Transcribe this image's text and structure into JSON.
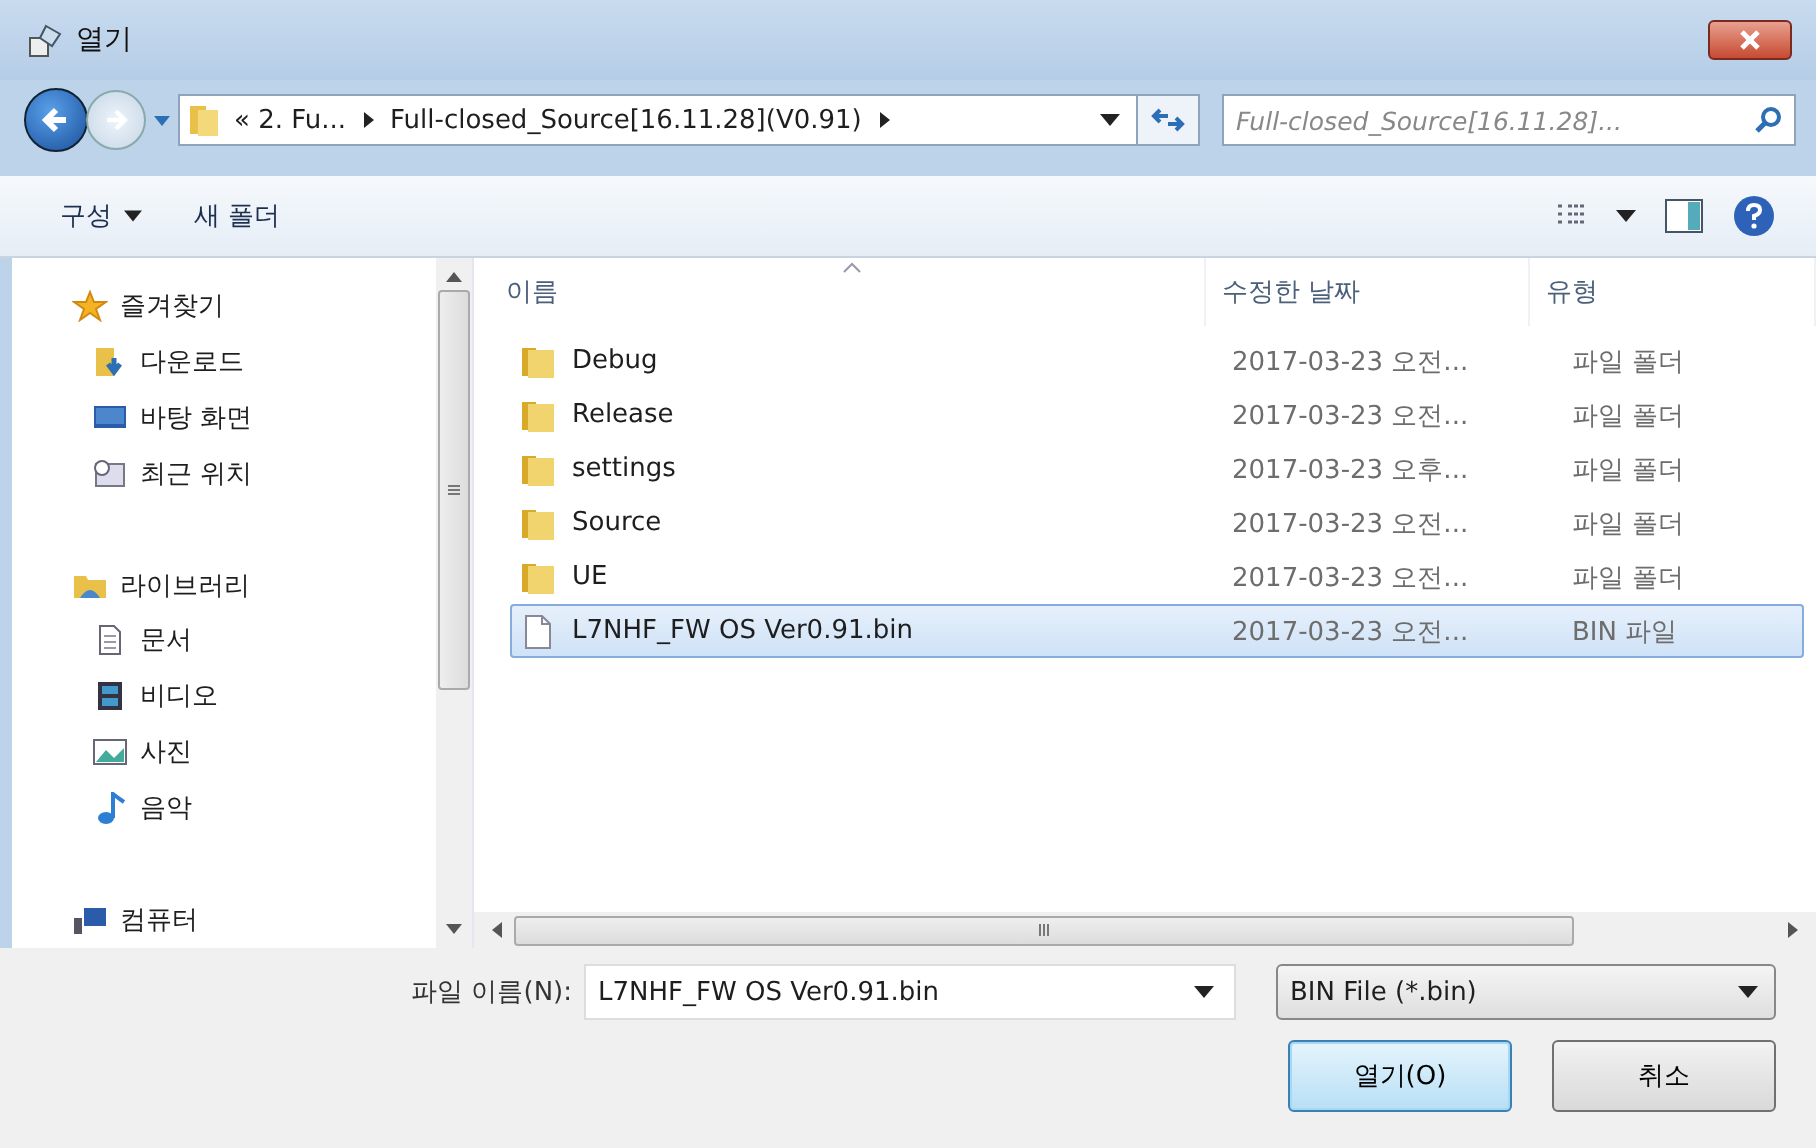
{
  "window": {
    "title": "열기"
  },
  "address": {
    "crumbs": [
      "« 2. Fu...",
      "Full-closed_Source[16.11.28](V0.91)"
    ],
    "search_placeholder": "Full-closed_Source[16.11.28]..."
  },
  "toolbar": {
    "organize": "구성",
    "new_folder": "새 폴더"
  },
  "sidebar": {
    "items": [
      {
        "label": "즐겨찾기",
        "kind": "group"
      },
      {
        "label": "다운로드",
        "kind": "item"
      },
      {
        "label": "바탕 화면",
        "kind": "item"
      },
      {
        "label": "최근 위치",
        "kind": "item"
      },
      {
        "label": "라이브러리",
        "kind": "group"
      },
      {
        "label": "문서",
        "kind": "item"
      },
      {
        "label": "비디오",
        "kind": "item"
      },
      {
        "label": "사진",
        "kind": "item"
      },
      {
        "label": "음악",
        "kind": "item"
      },
      {
        "label": "컴퓨터",
        "kind": "group"
      }
    ]
  },
  "table": {
    "columns": [
      "이름",
      "수정한 날짜",
      "유형"
    ],
    "rows": [
      {
        "name": "Debug",
        "date": "2017-03-23 오전...",
        "type": "파일 폴더",
        "kind": "folder",
        "selected": false
      },
      {
        "name": "Release",
        "date": "2017-03-23 오전...",
        "type": "파일 폴더",
        "kind": "folder",
        "selected": false
      },
      {
        "name": "settings",
        "date": "2017-03-23 오후...",
        "type": "파일 폴더",
        "kind": "folder",
        "selected": false
      },
      {
        "name": "Source",
        "date": "2017-03-23 오전...",
        "type": "파일 폴더",
        "kind": "folder",
        "selected": false
      },
      {
        "name": "UE",
        "date": "2017-03-23 오전...",
        "type": "파일 폴더",
        "kind": "folder",
        "selected": false
      },
      {
        "name": "L7NHF_FW OS Ver0.91.bin",
        "date": "2017-03-23 오전...",
        "type": "BIN 파일",
        "kind": "file",
        "selected": true
      }
    ]
  },
  "footer": {
    "filename_label": "파일 이름(N):",
    "filename": "L7NHF_FW OS Ver0.91.bin",
    "filter": "BIN File (*.bin)",
    "buttons": [
      {
        "label": "열기(O)",
        "default": true
      },
      {
        "label": "취소",
        "default": false
      }
    ]
  }
}
